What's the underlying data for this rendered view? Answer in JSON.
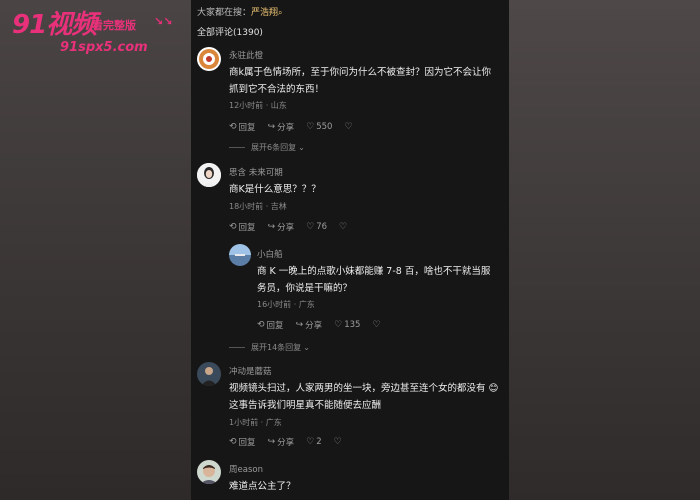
{
  "watermark": {
    "logo": "91视频",
    "tag": "看完整版",
    "arrows": "↘↘",
    "url": "91spx5.com"
  },
  "search": {
    "prefix": "大家都在搜：",
    "keyword": "严浩翔"
  },
  "comments_header": "全部评论(1390)",
  "actions": {
    "reply": "回复",
    "share": "分享"
  },
  "comments": [
    {
      "user": "永驻此橙",
      "text": "商k属于色情场所，至于你问为什么不被查封？因为它不会让你抓到它不合法的东西！",
      "meta": "12小时前 · 山东",
      "likes": "550",
      "expand": "展开6条回复"
    },
    {
      "user": "思含 未来可期",
      "text": "商K是什么意思？？？",
      "meta": "18小时前 · 吉林",
      "likes": "76"
    },
    {
      "user": "小白船",
      "text": "商 K 一晚上的点歌小妹都能赚 7-8 百，啥也不干就当服务员，你说是干嘛的？",
      "meta": "16小时前 · 广东",
      "likes": "135",
      "expand": "展开14条回复"
    },
    {
      "user": "冲动是蘑菇",
      "text": "视频镜头扫过，人家两男的坐一块，旁边甚至连个女的都没有 😊 这事告诉我们明星真不能随便去应酬",
      "meta": "1小时前 · 广东",
      "likes": "2"
    },
    {
      "user": "周eason",
      "text": "难道点公主了？"
    }
  ]
}
